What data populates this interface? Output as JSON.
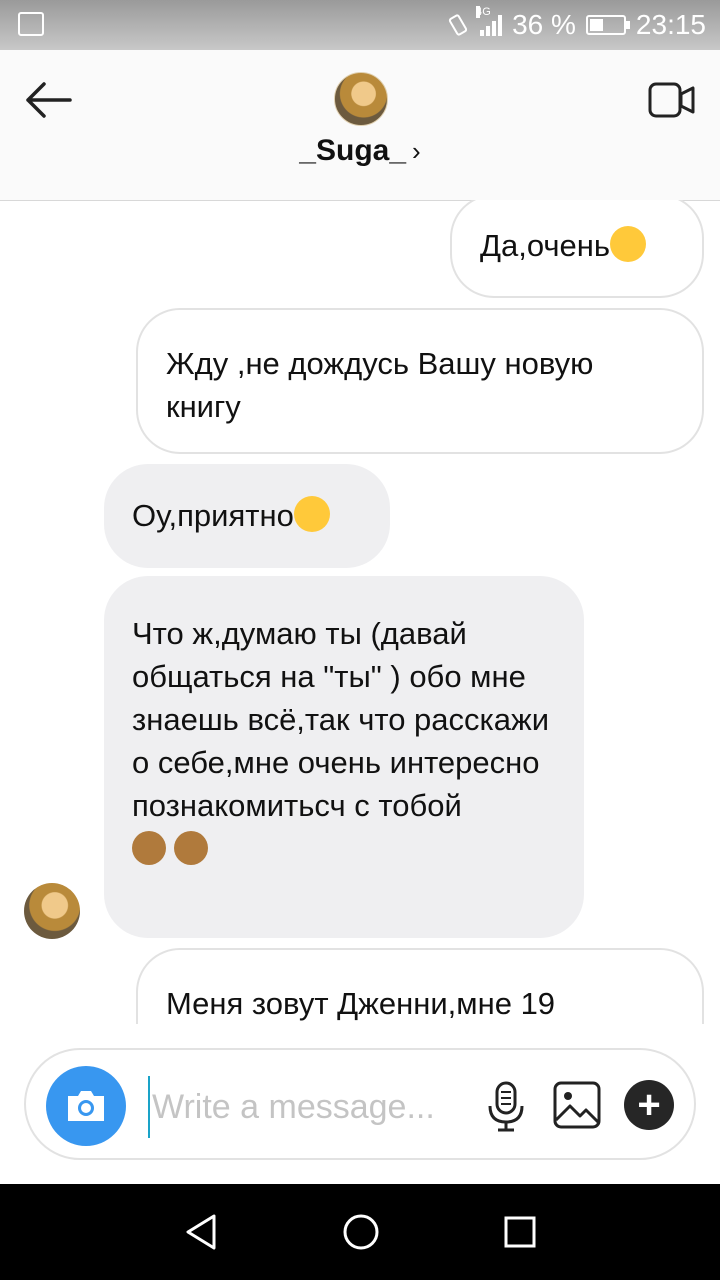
{
  "status_bar": {
    "network": "4G",
    "battery_percent": "36 %",
    "battery_level": 0.36,
    "time": "23:15"
  },
  "header": {
    "username": "_Suga_",
    "chevron": "›"
  },
  "messages": [
    {
      "direction": "outgoing",
      "text": "Да,очень",
      "emoji": "sleepy-face"
    },
    {
      "direction": "outgoing",
      "text": "Жду ,не дождусь Вашу новую книгу"
    },
    {
      "direction": "incoming",
      "text": "Оу,приятно",
      "emoji": "smiling-face"
    },
    {
      "direction": "incoming",
      "text": "Что ж,думаю ты (давай общаться на \"ты\" ) обо мне знаешь всё,так что расскажи о себе,мне очень интересно познакомитьсч с тобой",
      "emoji": "see-no-evil-monkey x2"
    },
    {
      "direction": "outgoing",
      "text": "Меня зовут Дженни,мне 19"
    }
  ],
  "composer": {
    "placeholder": "Write a message..."
  },
  "icons": {
    "back": "back-arrow-icon",
    "video": "video-call-icon",
    "camera": "camera-icon",
    "mic": "microphone-icon",
    "gallery": "gallery-icon",
    "plus": "plus-icon"
  },
  "colors": {
    "accent": "#3897f0",
    "incoming_bubble": "#efeff1",
    "outgoing_bubble_border": "#e2e2e2"
  }
}
